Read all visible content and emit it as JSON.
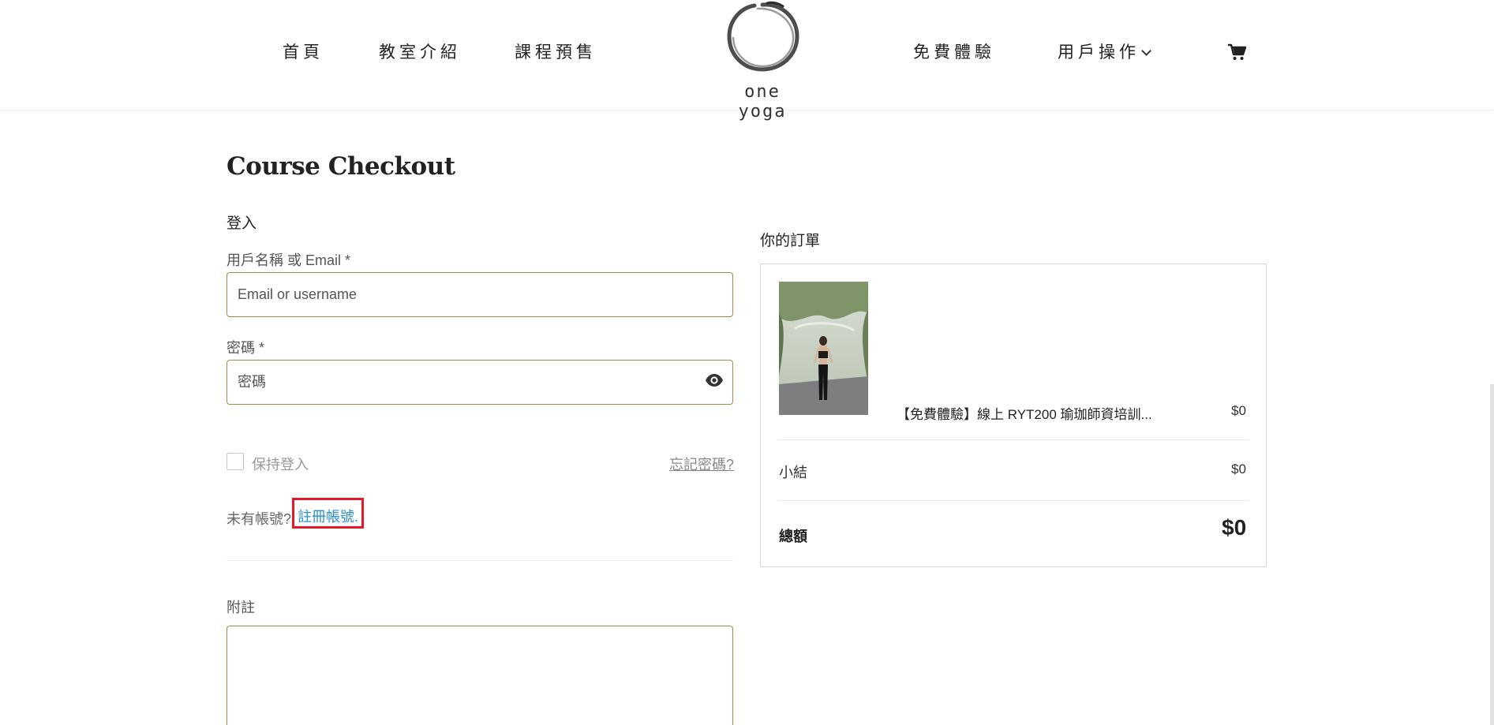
{
  "header": {
    "nav": {
      "home": "首頁",
      "studio": "教室介紹",
      "courses": "課程預售",
      "trial": "免費體驗",
      "user_menu": "用戶操作"
    },
    "logo_text": "one yoga",
    "icons": [
      "cart-icon",
      "chevron-down-icon",
      "logo-ring"
    ]
  },
  "checkout": {
    "title": "Course Checkout",
    "login": {
      "heading": "登入",
      "username_label": "用戶名稱 或 Email *",
      "username_placeholder": "Email or username",
      "password_label": "密碼 *",
      "password_placeholder": "密碼",
      "remember_label": "保持登入",
      "forgot_link": "忘記密碼?",
      "no_account_text": "未有帳號?",
      "register_link": "註冊帳號."
    },
    "notes_label": "附註"
  },
  "order": {
    "heading": "你的訂單",
    "item_name": "【免費體驗】線上 RYT200 瑜珈師資培訓...",
    "item_price": "$0",
    "subtotal_label": "小結",
    "subtotal_value": "$0",
    "total_label": "總額",
    "total_value": "$0"
  },
  "colors": {
    "input_border": "#a8884e",
    "link": "#2a8fd1",
    "highlight": "#e3192b"
  }
}
